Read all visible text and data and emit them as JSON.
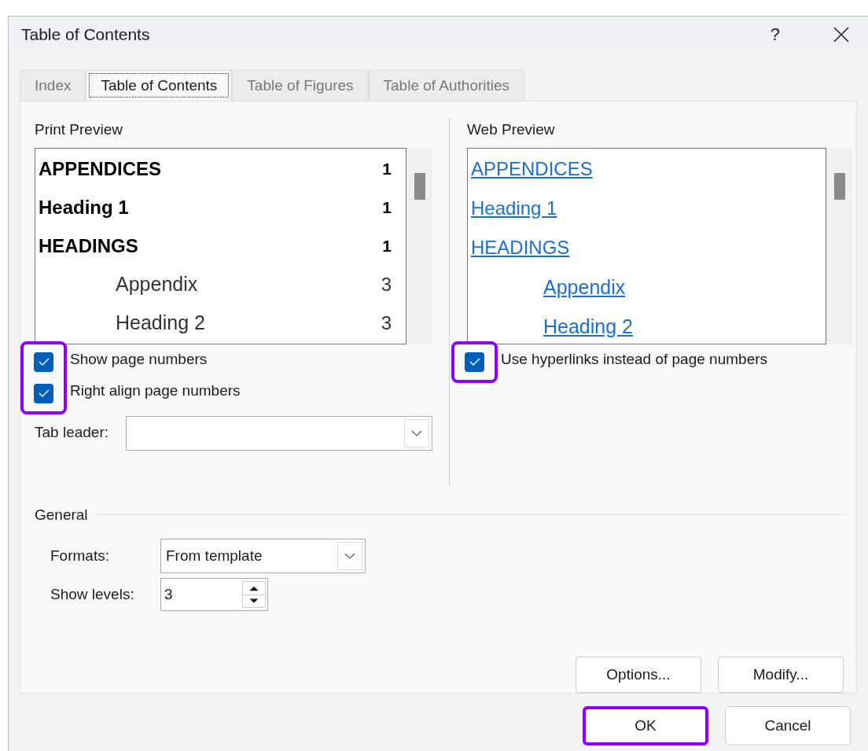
{
  "window": {
    "title": "Table of Contents",
    "help": "?"
  },
  "tabs": [
    {
      "label": "Index",
      "selected": false
    },
    {
      "label": "Table of Contents",
      "selected": true
    },
    {
      "label": "Table of Figures",
      "selected": false
    },
    {
      "label": "Table of Authorities",
      "selected": false
    }
  ],
  "print_preview": {
    "label": "Print Preview",
    "entries": [
      {
        "title": "APPENDICES",
        "page": "1",
        "kind": "main"
      },
      {
        "title": "Heading 1",
        "page": "1",
        "kind": "main"
      },
      {
        "title": "HEADINGS",
        "page": "1",
        "kind": "main"
      },
      {
        "title": "Appendix",
        "page": "3",
        "kind": "sub"
      },
      {
        "title": "Heading 2",
        "page": "3",
        "kind": "sub"
      }
    ]
  },
  "print_options": {
    "highlighted": true,
    "checkboxes": [
      {
        "label": "Show page numbers",
        "checked": true
      },
      {
        "label": "Right align page numbers",
        "checked": true
      }
    ]
  },
  "tab_leader": {
    "label": "Tab leader:"
  },
  "web_preview": {
    "label": "Web Preview",
    "entries": [
      {
        "title": "APPENDICES",
        "kind": "main"
      },
      {
        "title": "Heading 1",
        "kind": "main"
      },
      {
        "title": "HEADINGS",
        "kind": "main"
      },
      {
        "title": "Appendix",
        "kind": "sub"
      },
      {
        "title": "Heading 2",
        "kind": "sub"
      }
    ]
  },
  "web_options": {
    "highlighted": true,
    "checkboxes": [
      {
        "label": "Use hyperlinks instead of page numbers",
        "checked": true
      }
    ]
  },
  "general": {
    "label": "General",
    "formats": {
      "label": "Formats:",
      "value": "From template"
    },
    "show_levels": {
      "label": "Show levels:",
      "value": "3"
    }
  },
  "side_buttons": [
    {
      "label": "Options..."
    },
    {
      "label": "Modify..."
    }
  ],
  "footer_buttons": [
    {
      "label": "OK",
      "highlighted": true
    },
    {
      "label": "Cancel",
      "highlighted": false
    }
  ]
}
